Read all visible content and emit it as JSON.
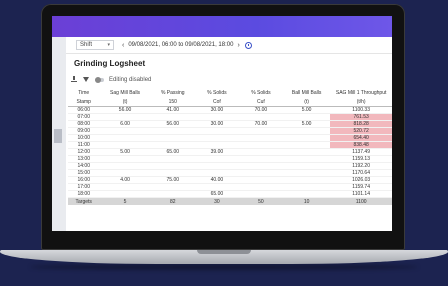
{
  "toolbar": {
    "shift_label": "Shift",
    "caret": "▾",
    "prev": "‹",
    "next": "›",
    "date_range": "09/08/2021, 06:00 to 09/08/2021, 18:00"
  },
  "page": {
    "title": "Grinding Logsheet",
    "editing_status": "Editing disabled"
  },
  "table": {
    "headers": [
      [
        "Time",
        "Stamp"
      ],
      [
        "Sag Mill Balls",
        "(t)"
      ],
      [
        "% Passing",
        "150"
      ],
      [
        "% Solids",
        "Cof"
      ],
      [
        "% Solids",
        "Cuf"
      ],
      [
        "Ball Mill Balls",
        "(t)"
      ],
      [
        "SAG Mill 1 Throughput",
        "(t/h)"
      ]
    ],
    "rows": [
      [
        "06:00",
        "56.00",
        "41.00",
        "30.00",
        "70.00",
        "5.00",
        "1100.33"
      ],
      [
        "07:00",
        "",
        "",
        "",
        "",
        "",
        "761.53"
      ],
      [
        "08:00",
        "6.00",
        "56.00",
        "30.00",
        "70.00",
        "5.00",
        "818.28"
      ],
      [
        "09:00",
        "",
        "",
        "",
        "",
        "",
        "520.72"
      ],
      [
        "10:00",
        "",
        "",
        "",
        "",
        "",
        "654.40"
      ],
      [
        "11:00",
        "",
        "",
        "",
        "",
        "",
        "838.48"
      ],
      [
        "12:00",
        "5.00",
        "65.00",
        "39.00",
        "",
        "",
        "1137.49"
      ],
      [
        "13:00",
        "",
        "",
        "",
        "",
        "",
        "1159.13"
      ],
      [
        "14:00",
        "",
        "",
        "",
        "",
        "",
        "1192.20"
      ],
      [
        "15:00",
        "",
        "",
        "",
        "",
        "",
        "1170.64"
      ],
      [
        "16:00",
        "4.00",
        "75.00",
        "40.00",
        "",
        "",
        "1026.03"
      ],
      [
        "17:00",
        "",
        "",
        "",
        "",
        "",
        "1159.74"
      ],
      [
        "18:00",
        "",
        "",
        "65.00",
        "",
        "",
        "1101.14"
      ]
    ],
    "highlighted_rows": [
      1,
      2,
      3,
      4,
      5
    ],
    "highlight_color": "#f2b8bd",
    "targets": [
      "Targets",
      "5",
      "82",
      "30",
      "50",
      "10",
      "1100"
    ]
  },
  "colors": {
    "header_bar": "#5b4be0",
    "accent": "#3b52c8"
  }
}
